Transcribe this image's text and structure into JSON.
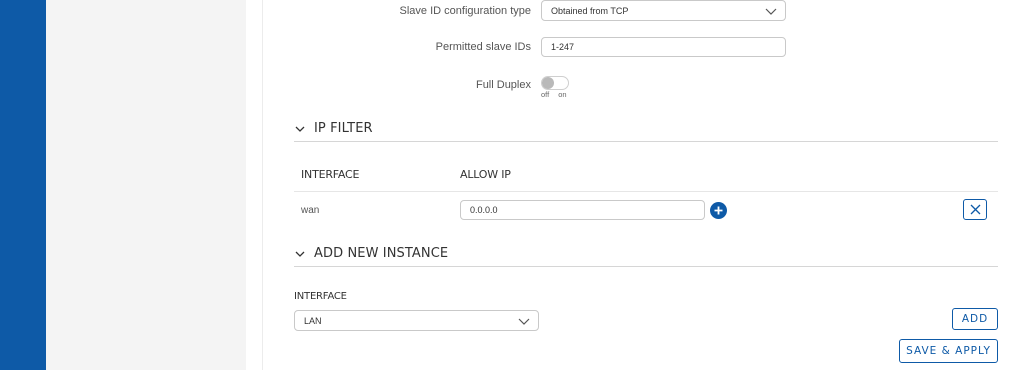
{
  "fields": {
    "slave_id_type": {
      "label": "Slave ID configuration type",
      "value": "Obtained from TCP"
    },
    "permitted_ids": {
      "label": "Permitted slave IDs",
      "value": "1-247"
    },
    "full_duplex": {
      "label": "Full Duplex",
      "off_label": "off",
      "on_label": "on",
      "state": "off"
    }
  },
  "ip_filter": {
    "title": "IP FILTER",
    "columns": [
      "INTERFACE",
      "ALLOW IP"
    ],
    "rows": [
      {
        "interface": "wan",
        "allow_ip": "0.0.0.0"
      }
    ]
  },
  "add_instance": {
    "title": "ADD NEW INSTANCE",
    "interface_label": "INTERFACE",
    "interface_value": "LAN",
    "add_label": "ADD"
  },
  "footer": {
    "save_apply_label": "SAVE & APPLY"
  },
  "colors": {
    "accent": "#0e5aa7",
    "sidebar": "#0e5aa7",
    "panel": "#f4f4f4"
  }
}
